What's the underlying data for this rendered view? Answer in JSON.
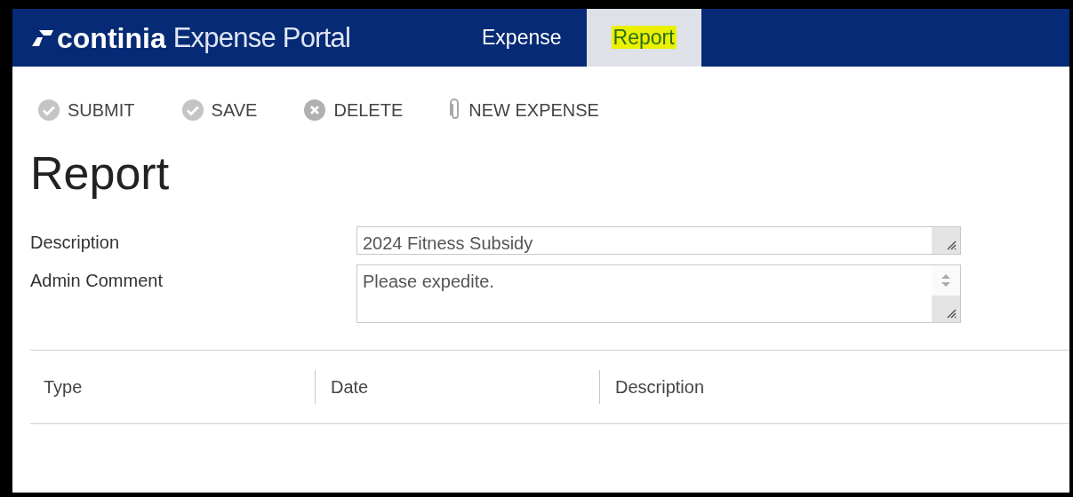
{
  "header": {
    "brand": "continia",
    "product": "Expense Portal",
    "tabs": [
      {
        "label": "Expense",
        "selected": false,
        "highlighted": false
      },
      {
        "label": "Report",
        "selected": true,
        "highlighted": true
      }
    ]
  },
  "toolbar": [
    {
      "label": "SUBMIT",
      "kind": "check"
    },
    {
      "label": "SAVE",
      "kind": "check"
    },
    {
      "label": "DELETE",
      "kind": "delete"
    },
    {
      "label": "NEW EXPENSE",
      "kind": "attach"
    }
  ],
  "title": "Report",
  "fields": [
    {
      "label": "Description",
      "value": "2024 Fitness Subsidy",
      "kind": "single"
    },
    {
      "label": "Admin Comment",
      "value": "Please expedite.",
      "kind": "multi"
    }
  ],
  "table": {
    "columns": [
      "Type",
      "Date",
      "Description"
    ]
  }
}
